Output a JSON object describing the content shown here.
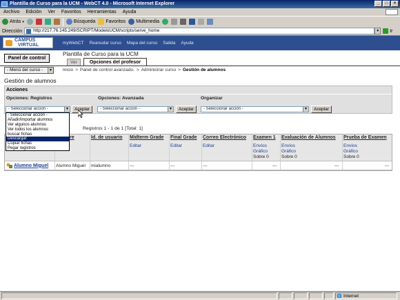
{
  "window": {
    "title": "Plantilla de Curso para la UCM - WebCT 4.0 - Microsoft Internet Explorer"
  },
  "menubar": {
    "items": [
      "Archivo",
      "Edición",
      "Ver",
      "Favoritos",
      "Herramientas",
      "Ayuda"
    ]
  },
  "toolbar": {
    "back": "Atrás",
    "search": "Búsqueda",
    "favorites": "Favoritos",
    "multimedia": "Multimedia"
  },
  "address": {
    "label": "Dirección",
    "url": "http://217.76.145.249/SCRIPT/ModeloUCM/scripts/serve_home",
    "go": "Ir"
  },
  "header": {
    "logo_line1": "CAMPUS",
    "logo_line2": "VIRTUAL",
    "nav": [
      "myWebCT",
      "Reanudar curso",
      "Mapa del curso",
      "Salida",
      "Ayuda"
    ]
  },
  "control_panel_button": "Panel de control",
  "course_title": "Plantilla de Curso para la UCM",
  "tabs": {
    "ver": "Ver",
    "profesor": "Opciones del profesor"
  },
  "course_menu": "- Menú del curso -",
  "breadcrumb": {
    "items": [
      "Inicio",
      ">",
      "Panel de control avanzado.",
      ">",
      "Administrar curso",
      ">"
    ],
    "current": "Gestión de alumnos"
  },
  "page_title": "Gestión de alumnos",
  "acciones": {
    "title": "Acciones",
    "registros_label": "Opciones: Registros",
    "avanzada_label": "Opciones: Avanzada",
    "organizar_label": "Organizar",
    "select_placeholder": "- Seleccionar acción -",
    "accept": "Aceptar"
  },
  "dropdown": {
    "options": [
      "- Seleccionar acción -",
      "Añadir/importar alumnos",
      "Ver algunos alumnos",
      "Ver todos los alumnos",
      "buscar fichas",
      "Descargar",
      "Copiar fichas",
      "Pegar registros"
    ],
    "highlighted": "Descargar"
  },
  "records": "Registros 1 - 1 de 1 [Total: 1]",
  "table": {
    "headers": [
      "re",
      "Id. de usuario",
      "Midterm Grade",
      "Final Grade",
      "Correo Electrónico",
      "Examen 1",
      "Evaluación de Alumnos",
      "Prueba de Examen"
    ],
    "sub_editar": "Editar",
    "sub_envios": "Envíos",
    "sub_grafico": "Gráfico",
    "sub_sobre": "Sobre 0",
    "row": {
      "name": "Alumno Miguel",
      "fullname": "Alumno Miguel",
      "user_id": "mialumno",
      "empty": "---"
    }
  },
  "statusbar": {
    "zone": "Internet"
  }
}
